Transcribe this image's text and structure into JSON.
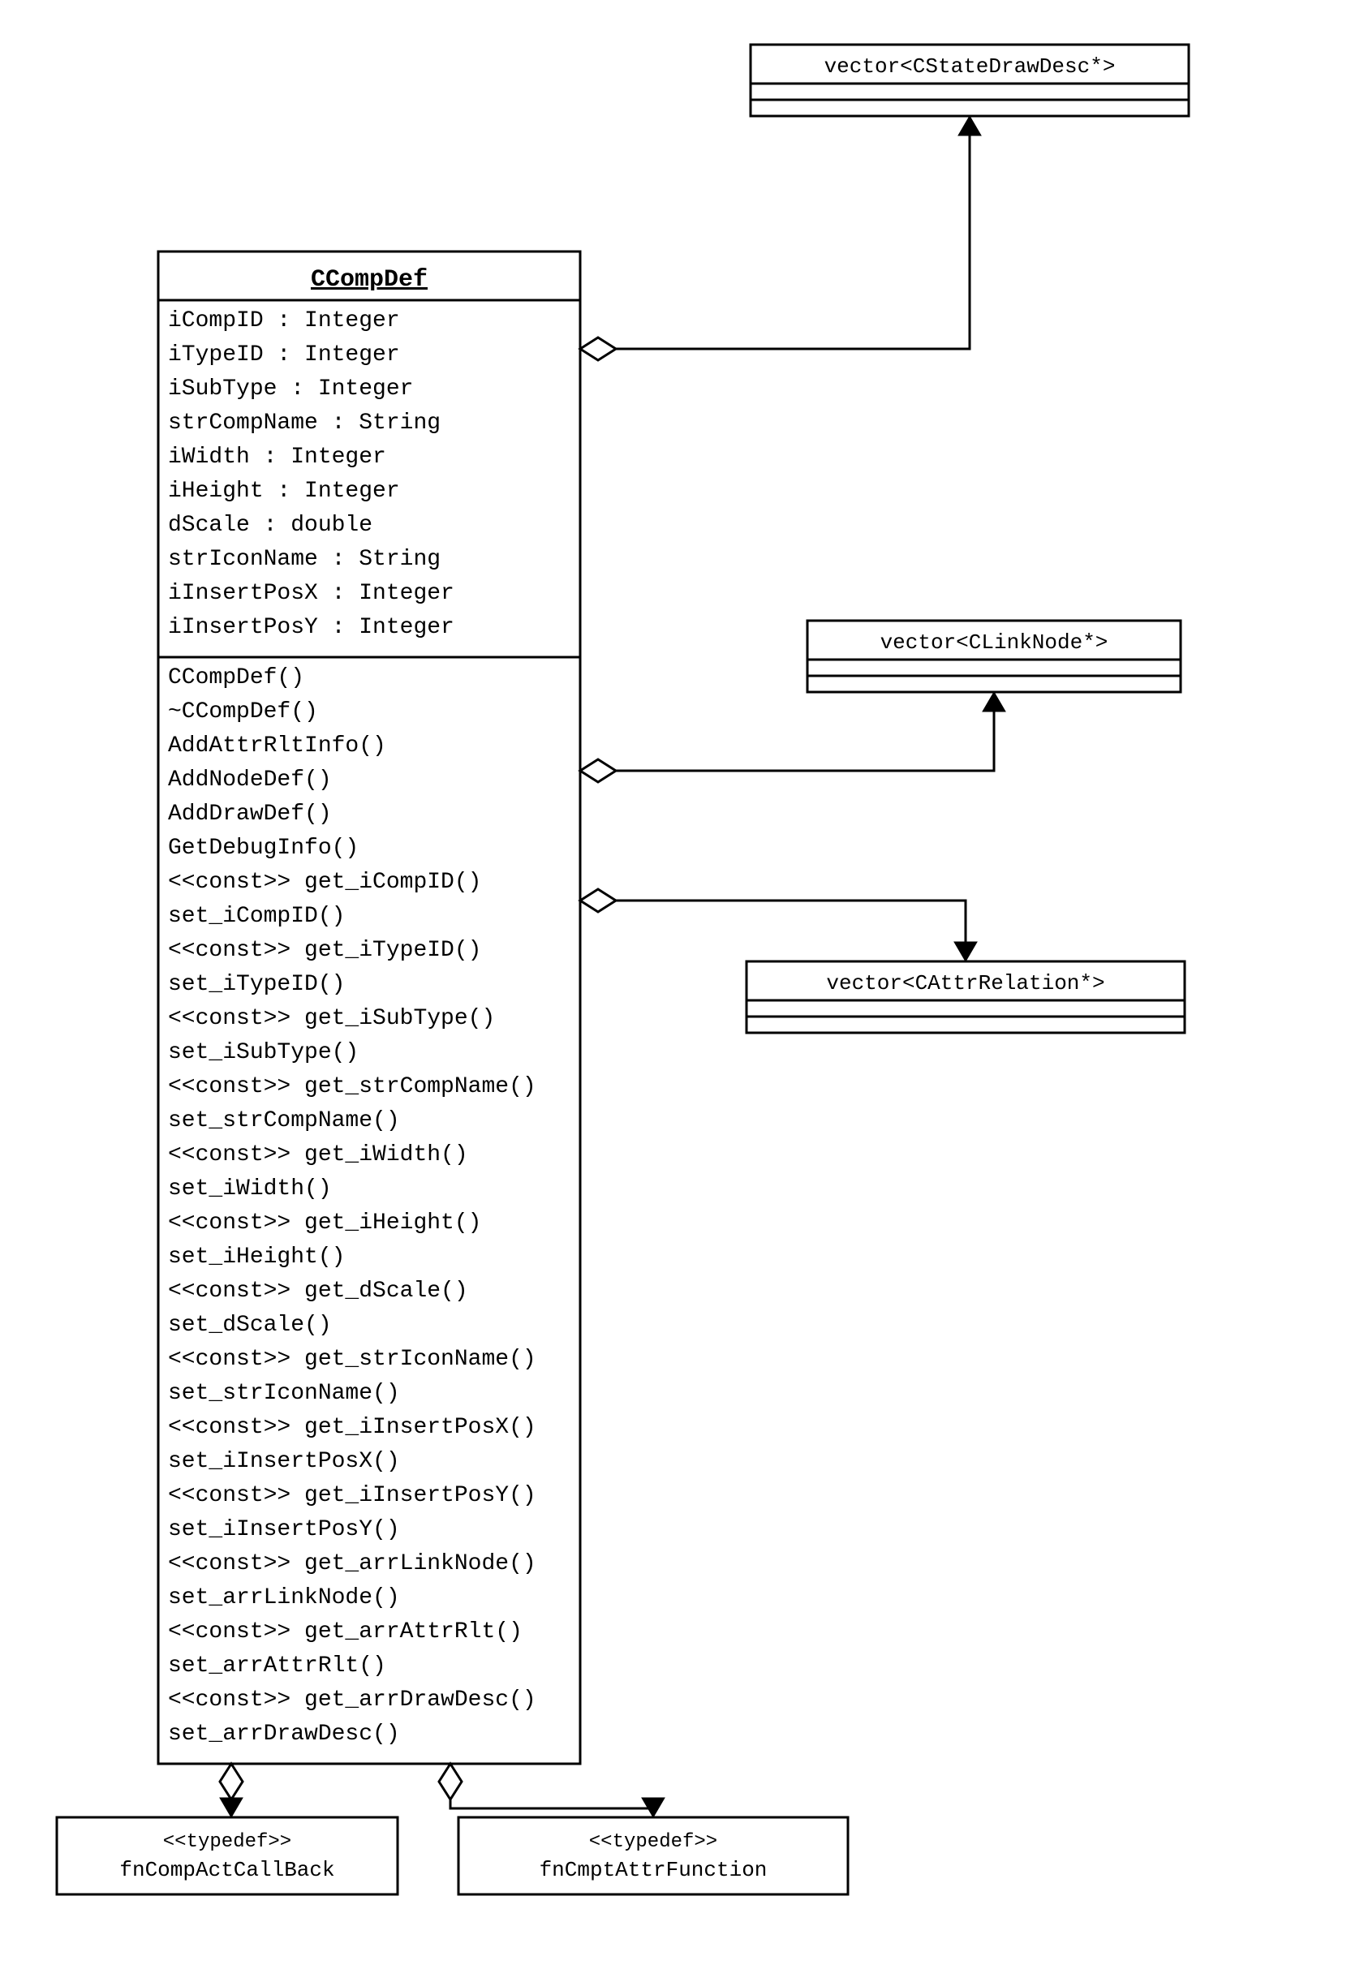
{
  "mainClass": {
    "name": "CCompDef",
    "attributes": [
      "iCompID : Integer",
      "iTypeID : Integer",
      "iSubType : Integer",
      "strCompName : String",
      "iWidth : Integer",
      "iHeight : Integer",
      "dScale : double",
      "strIconName : String",
      "iInsertPosX : Integer",
      "iInsertPosY : Integer"
    ],
    "operations": [
      "CCompDef()",
      "~CCompDef()",
      "AddAttrRltInfo()",
      "AddNodeDef()",
      "AddDrawDef()",
      "GetDebugInfo()",
      "<<const>> get_iCompID()",
      "set_iCompID()",
      "<<const>> get_iTypeID()",
      "set_iTypeID()",
      "<<const>> get_iSubType()",
      "set_iSubType()",
      "<<const>> get_strCompName()",
      "set_strCompName()",
      "<<const>> get_iWidth()",
      "set_iWidth()",
      "<<const>> get_iHeight()",
      "set_iHeight()",
      "<<const>> get_dScale()",
      "set_dScale()",
      "<<const>> get_strIconName()",
      "set_strIconName()",
      "<<const>> get_iInsertPosX()",
      "set_iInsertPosX()",
      "<<const>> get_iInsertPosY()",
      "set_iInsertPosY()",
      "<<const>> get_arrLinkNode()",
      "set_arrLinkNode()",
      "<<const>> get_arrAttrRlt()",
      "set_arrAttrRlt()",
      "<<const>> get_arrDrawDesc()",
      "set_arrDrawDesc()"
    ]
  },
  "rightClasses": [
    {
      "name": "vector<CStateDrawDesc*>"
    },
    {
      "name": "vector<CLinkNode*>"
    },
    {
      "name": "vector<CAttrRelation*>"
    }
  ],
  "bottomClasses": [
    {
      "stereo": "<<typedef>>",
      "name": "fnCompActCallBack"
    },
    {
      "stereo": "<<typedef>>",
      "name": "fnCmptAttrFunction"
    }
  ]
}
